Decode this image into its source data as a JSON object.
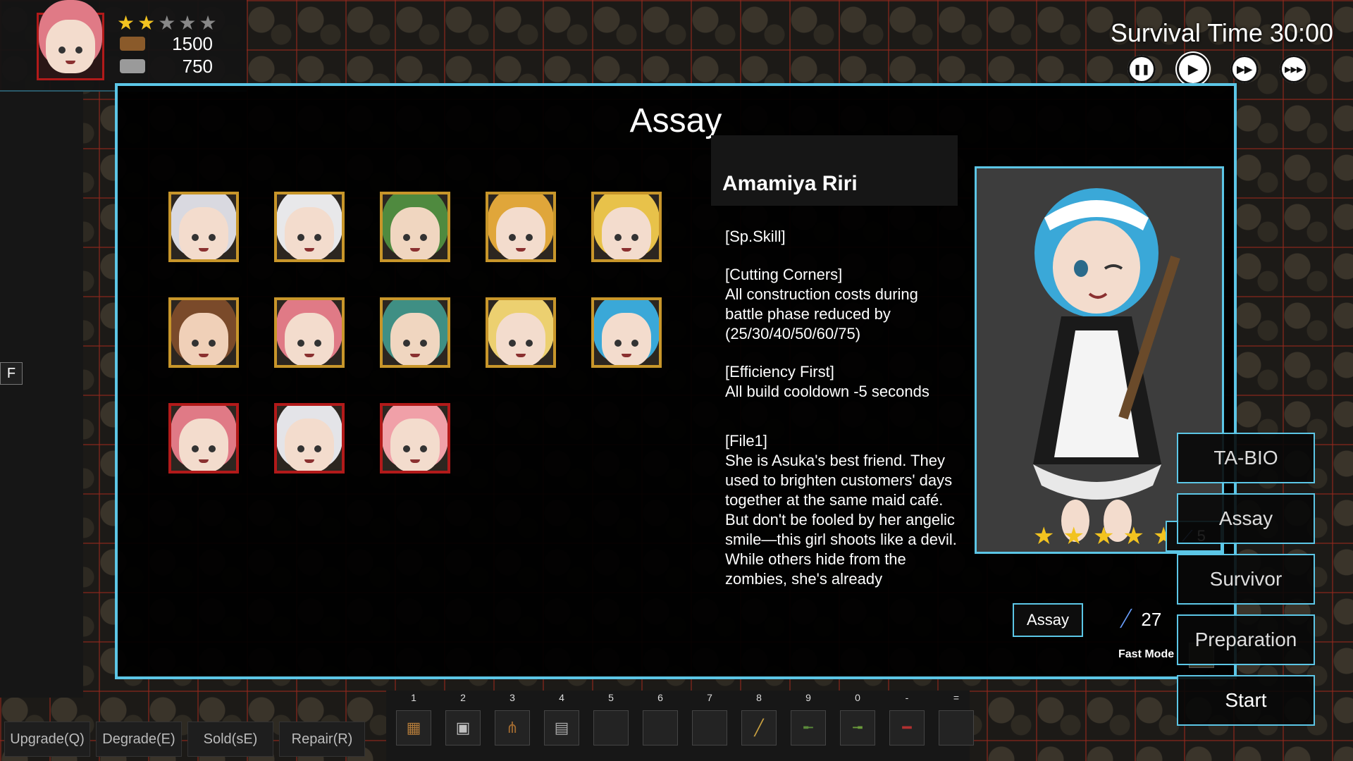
{
  "hud": {
    "stars_filled": 2,
    "stars_total": 5,
    "resources": [
      {
        "icon": "wood-log-icon",
        "value": "1500"
      },
      {
        "icon": "metal-ingot-icon",
        "value": "750"
      }
    ]
  },
  "survival_time": "Survival Time 30:00",
  "speed_controls": [
    {
      "name": "pause-button",
      "glyph": "❚❚"
    },
    {
      "name": "play-button",
      "glyph": "▶"
    },
    {
      "name": "fast-forward-button",
      "glyph": "▶▶"
    },
    {
      "name": "fastest-forward-button",
      "glyph": "▶▶▶"
    }
  ],
  "f_key": "F",
  "panel": {
    "title": "Assay",
    "character": {
      "name": "Amamiya Riri",
      "description": [
        "[Sp.Skill]",
        "[Cutting Corners]\nAll construction costs during battle phase reduced by (25/30/40/50/60/75)",
        "[Efficiency First]\nAll build cooldown -5 seconds",
        "[File1]\nShe is Asuka's best friend. They used to brighten customers' days together at the same maid café. But don't be fooled by her angelic smile—this girl shoots like a devil. While others hide from the zombies, she's already"
      ],
      "stars": 5,
      "level": "5"
    },
    "assay_button": "Assay",
    "cost": "27",
    "fast_mode_label": "Fast Mode"
  },
  "roster": [
    {
      "hair": "#d9d9e0",
      "skin": "#f3dccd",
      "frame": "gold"
    },
    {
      "hair": "#e8e8ea",
      "skin": "#f3dccd",
      "frame": "gold"
    },
    {
      "hair": "#4f8a3f",
      "skin": "#f0d6c0",
      "frame": "gold"
    },
    {
      "hair": "#e0a63a",
      "skin": "#f3dccd",
      "frame": "gold"
    },
    {
      "hair": "#e8c24a",
      "skin": "#f3dccd",
      "frame": "gold"
    },
    {
      "hair": "#7a4a2a",
      "skin": "#f0d0b8",
      "frame": "gold"
    },
    {
      "hair": "#e07a86",
      "skin": "#f3dccd",
      "frame": "gold"
    },
    {
      "hair": "#3f8f84",
      "skin": "#f0d6c0",
      "frame": "gold"
    },
    {
      "hair": "#ecd070",
      "skin": "#f3dccd",
      "frame": "gold"
    },
    {
      "hair": "#3aa8d8",
      "skin": "#f3dccd",
      "frame": "gold"
    },
    {
      "hair": "#e07a86",
      "skin": "#f3dccd",
      "frame": "red"
    },
    {
      "hair": "#e4e4e8",
      "skin": "#f3dccd",
      "frame": "red"
    },
    {
      "hair": "#f0a0a8",
      "skin": "#f3dccd",
      "frame": "red"
    }
  ],
  "side_menu": [
    "TA-BIO",
    "Assay",
    "Survivor",
    "Preparation",
    "Start"
  ],
  "bottom_buttons": [
    "Upgrade(Q)",
    "Degrade(E)",
    "Sold(sE)",
    "Repair(R)"
  ],
  "hotbar": [
    {
      "key": "1",
      "icon": "wooden-barricade-icon"
    },
    {
      "key": "2",
      "icon": "crate-icon"
    },
    {
      "key": "3",
      "icon": "spike-trap-icon"
    },
    {
      "key": "4",
      "icon": "fence-icon"
    },
    {
      "key": "5",
      "icon": ""
    },
    {
      "key": "6",
      "icon": ""
    },
    {
      "key": "7",
      "icon": ""
    },
    {
      "key": "8",
      "icon": "sniper-rifle-icon"
    },
    {
      "key": "9",
      "icon": "assault-rifle-icon"
    },
    {
      "key": "0",
      "icon": "rifle-icon"
    },
    {
      "key": "-",
      "icon": "shotgun-icon"
    },
    {
      "key": "=",
      "icon": ""
    }
  ]
}
